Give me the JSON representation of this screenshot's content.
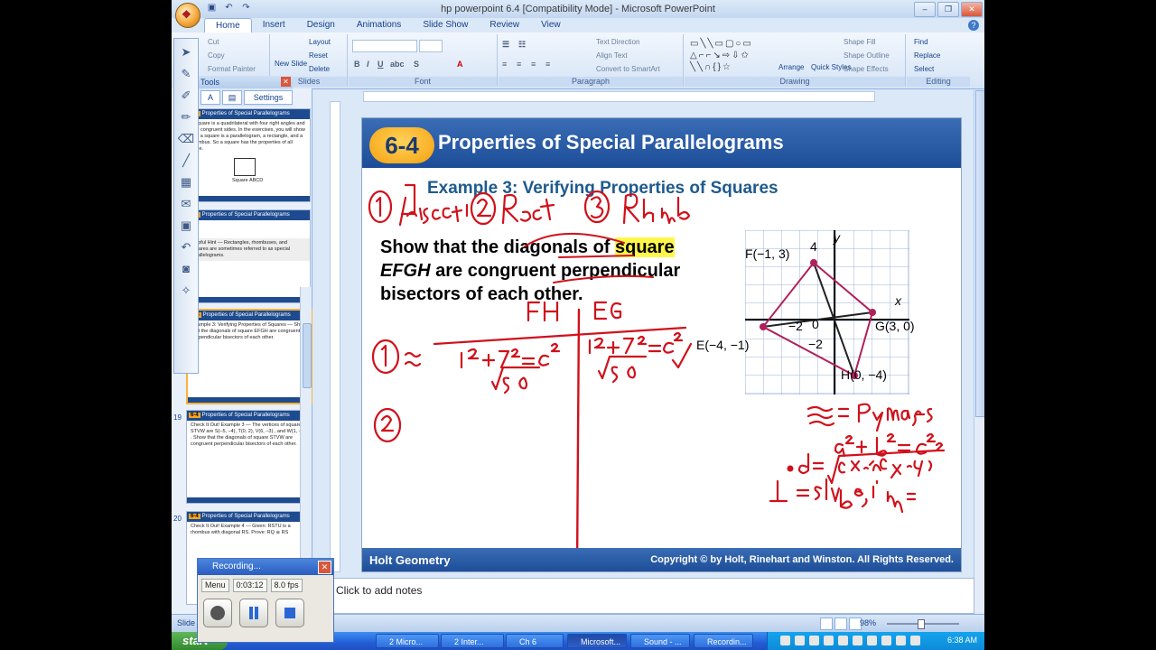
{
  "window": {
    "title": "hp powerpoint 6.4 [Compatibility Mode] - Microsoft PowerPoint",
    "controls": [
      "–",
      "❐",
      "✕"
    ]
  },
  "ribbon_tabs": [
    "Home",
    "Insert",
    "Design",
    "Animations",
    "Slide Show",
    "Review",
    "View"
  ],
  "ribbon": {
    "clipboard": {
      "cut": "Cut",
      "copy": "Copy",
      "format_painter": "Format Painter"
    },
    "slides": {
      "new_slide": "New Slide",
      "layout": "Layout",
      "reset": "Reset",
      "delete": "Delete",
      "label": "Slides"
    },
    "font_label": "Font",
    "paragraph": {
      "text_direction": "Text Direction",
      "align_text": "Align Text",
      "convert": "Convert to SmartArt",
      "label": "Paragraph"
    },
    "drawing": {
      "arrange": "Arrange",
      "quick_styles": "Quick Styles",
      "shape_fill": "Shape Fill",
      "shape_outline": "Shape Outline",
      "shape_effects": "Shape Effects",
      "label": "Drawing"
    },
    "editing": {
      "find": "Find",
      "replace": "Replace",
      "select": "Select",
      "label": "Editing"
    }
  },
  "pane": {
    "tools_label": "Tools",
    "settings": "Settings",
    "slide_numbers": [
      "19",
      "20"
    ],
    "thumbs": [
      {
        "title": "Properties of Special Parallelograms",
        "text": "A square is a quadrilateral with four right angles and four congruent sides. In the exercises, you will show that a square is a parallelogram, a rectangle, and a rhombus. So a square has the properties of all three.",
        "caption": "Square ABCD"
      },
      {
        "title": "Properties of Special Parallelograms",
        "text": "Helpful Hint — Rectangles, rhombuses, and squares are sometimes referred to as special parallelograms."
      },
      {
        "title": "Properties of Special Parallelograms",
        "text": "Example 3: Verifying Properties of Squares — Show that the diagonals of square EFGH are congruent perpendicular bisectors of each other."
      },
      {
        "title": "Properties of Special Parallelograms",
        "text": "Check It Out! Example 3 — The vertices of square STVW are S(–5, –4), T(0, 2), V(6, –3) , and W(1, –9) . Show that the diagonals of square STVW are congruent perpendicular bisectors of each other."
      },
      {
        "title": "Properties of Special Parallelograms",
        "text": "Check It Out! Example 4 — Given: RSTU is a rhombus with diagonal RS. Prove: RQ ≅ RS"
      }
    ]
  },
  "slide": {
    "badge": "6-4",
    "title": "Properties of Special Parallelograms",
    "example": "Example 3: Verifying Properties of Squares",
    "problem_parts": {
      "p1": "Show that the diagonals of ",
      "hl": "square",
      "p2": " ",
      "em": "EFGH",
      "p3": " are congruent perpendicular bisectors of each other."
    },
    "footer_left": "Holt Geometry",
    "footer_right": "Copyright © by Holt, Rinehart and Winston. All Rights Reserved.",
    "graph_labels": {
      "F": "F(−1, 3)",
      "E": "E(−4, −1)",
      "G": "G(3, 0)",
      "H": "H(0, −4)",
      "x": "x",
      "y": "y",
      "four": "4",
      "neg2x": "−2",
      "zero": "0",
      "neg2y": "−2"
    }
  },
  "notes_placeholder": "Click to add notes",
  "status": {
    "slide": "Slide 1",
    "zoom": "98%"
  },
  "recorder": {
    "title": "Recording...",
    "menu": "Menu",
    "time": "0:03:12",
    "fps": "8.0 fps"
  },
  "taskbar": {
    "start": "start",
    "items": [
      "2 Micro...",
      "2 Inter...",
      "Ch 6",
      "Microsoft...",
      "Sound - ...",
      "Recordin..."
    ],
    "clock": "6:38 AM"
  },
  "colors": {
    "ink": "#d0111b",
    "slide_blue": "#1d4d98",
    "accent_gold": "#f7a51e",
    "graph_square": "#b0205a"
  }
}
